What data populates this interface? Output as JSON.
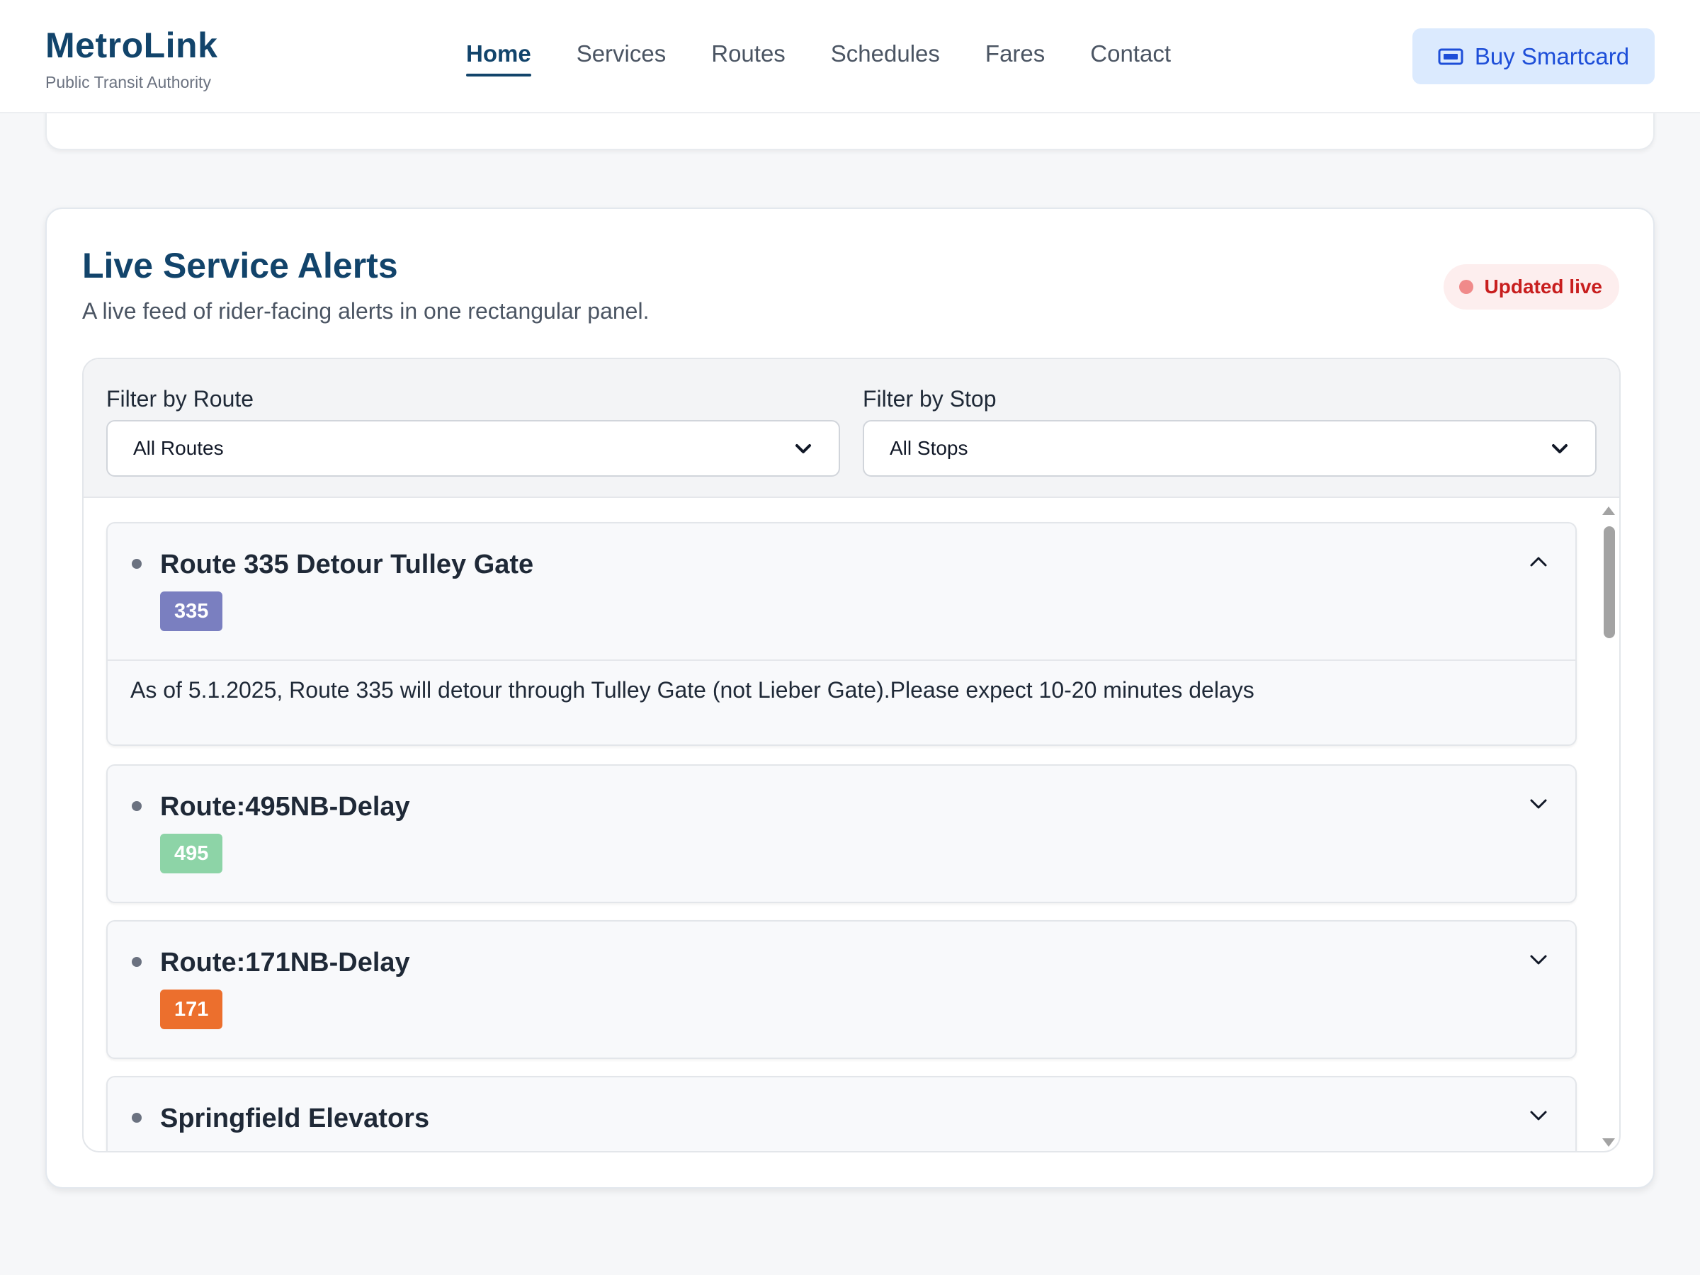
{
  "header": {
    "brand_name": "MetroLink",
    "brand_sub": "Public Transit Authority",
    "nav": [
      {
        "label": "Home",
        "active": true
      },
      {
        "label": "Services"
      },
      {
        "label": "Routes"
      },
      {
        "label": "Schedules"
      },
      {
        "label": "Fares"
      },
      {
        "label": "Contact"
      }
    ],
    "buy_button": "Buy Smartcard",
    "buy_icon": "ticket-icon"
  },
  "alerts": {
    "title": "Live Service Alerts",
    "subtitle": "A live feed of rider-facing alerts in one rectangular panel.",
    "live_badge": "Updated live",
    "filters": {
      "route_label": "Filter by Route",
      "route_value": "All Routes",
      "stop_label": "Filter by Stop",
      "stop_value": "All Stops"
    },
    "items": [
      {
        "title": "Route 335 Detour Tulley Gate",
        "route": "335",
        "route_color": "#7a7fc0",
        "expanded": true,
        "body": "As of 5.1.2025, Route 335 will detour through Tulley Gate (not Lieber Gate).Please expect 10-20 minutes delays"
      },
      {
        "title": "Route:495NB-Delay",
        "route": "495",
        "route_color": "#8dd4a7",
        "expanded": false
      },
      {
        "title": "Route:171NB-Delay",
        "route": "171",
        "route_color": "#ec6f2d",
        "expanded": false
      },
      {
        "title": "Springfield Elevators",
        "expanded": false
      }
    ]
  },
  "colors": {
    "brand": "#12446b",
    "accent": "#1d4ed8",
    "live": "#c81e1e"
  }
}
